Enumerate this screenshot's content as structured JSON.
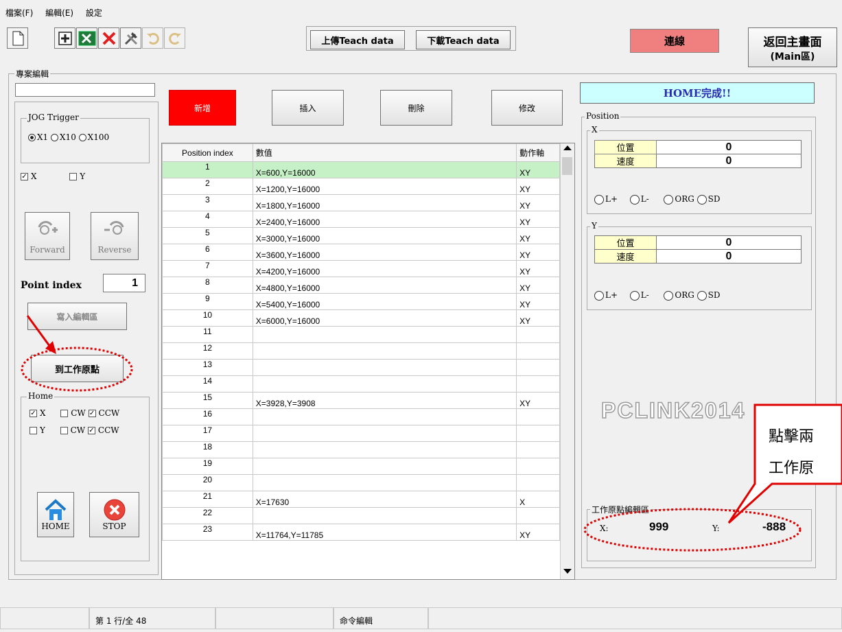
{
  "menu": [
    "檔案(F)",
    "編輯(E)",
    "設定"
  ],
  "toolbar": {
    "upload_label": "上傳Teach data",
    "download_label": "下載Teach data",
    "connect_label": "連線",
    "main_label_line1": "返回主畫面",
    "main_label_line2": "(Main區)",
    "connect_color": "#f08080"
  },
  "project": {
    "group_label": "專案編輯",
    "name_value": "",
    "jog_label": "JOG Trigger",
    "jog_options": [
      "X1",
      "X10",
      "X100"
    ],
    "axis_x": "X",
    "axis_y": "Y",
    "forward_label": "Forward",
    "reverse_label": "Reverse",
    "point_index_label": "Point index",
    "point_index_value": "1",
    "write_label": "寫入編輯區",
    "origin_label": "到工作原點",
    "home_group_label": "Home",
    "home_x": "X",
    "home_y": "Y",
    "cw": "CW",
    "ccw": "CCW",
    "home_button": "HOME",
    "stop_button": "STOP"
  },
  "actions": {
    "add": "新增",
    "insert": "插入",
    "delete": "刪除",
    "modify": "修改"
  },
  "table": {
    "headers": [
      "Position index",
      "數值",
      "動作軸"
    ],
    "rows": [
      [
        "1",
        "X=600,Y=16000",
        "XY"
      ],
      [
        "2",
        "X=1200,Y=16000",
        "XY"
      ],
      [
        "3",
        "X=1800,Y=16000",
        "XY"
      ],
      [
        "4",
        "X=2400,Y=16000",
        "XY"
      ],
      [
        "5",
        "X=3000,Y=16000",
        "XY"
      ],
      [
        "6",
        "X=3600,Y=16000",
        "XY"
      ],
      [
        "7",
        "X=4200,Y=16000",
        "XY"
      ],
      [
        "8",
        "X=4800,Y=16000",
        "XY"
      ],
      [
        "9",
        "X=5400,Y=16000",
        "XY"
      ],
      [
        "10",
        "X=6000,Y=16000",
        "XY"
      ],
      [
        "11",
        "",
        ""
      ],
      [
        "12",
        "",
        ""
      ],
      [
        "13",
        "",
        ""
      ],
      [
        "14",
        "",
        ""
      ],
      [
        "15",
        "X=3928,Y=3908",
        "XY"
      ],
      [
        "16",
        "",
        ""
      ],
      [
        "17",
        "",
        ""
      ],
      [
        "18",
        "",
        ""
      ],
      [
        "19",
        "",
        ""
      ],
      [
        "20",
        "",
        ""
      ],
      [
        "21",
        "X=17630",
        "X"
      ],
      [
        "22",
        "",
        ""
      ],
      [
        "23",
        "X=11764,Y=11785",
        "XY"
      ]
    ]
  },
  "right": {
    "home_status": "HOME完成!!",
    "position_label": "Position",
    "x_label": "X",
    "y_label": "Y",
    "pos_label": "位置",
    "speed_label": "速度",
    "x_pos": "0",
    "x_speed": "0",
    "y_pos": "0",
    "y_speed": "0",
    "limits": [
      "L+",
      "L-",
      "ORG",
      "SD"
    ],
    "watermark": "PCLINK2014",
    "origin_group_label": "工作原點編輯區",
    "origin_x_label": "X:",
    "origin_x": "999",
    "origin_y_label": "Y:",
    "origin_y": "-888",
    "callout_line1": "點擊兩",
    "callout_line2": "工作原"
  },
  "status": {
    "row_info": "第 1 行/全 48",
    "mode": "命令編輯"
  }
}
